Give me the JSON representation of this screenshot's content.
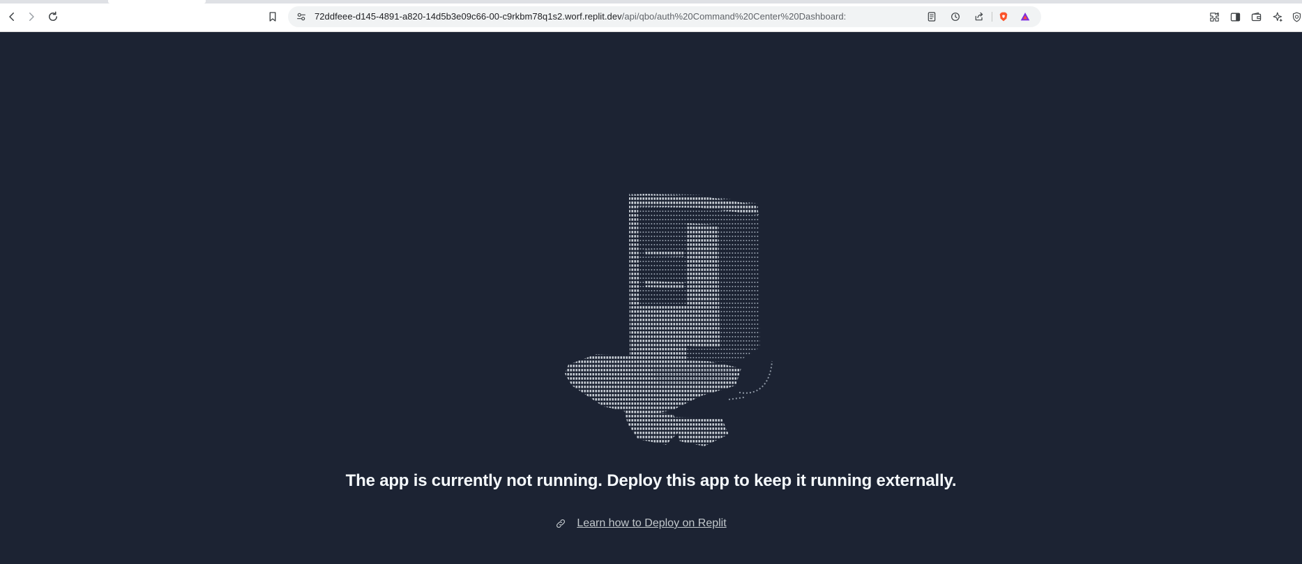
{
  "browser": {
    "url_host": "72ddfeee-d145-4891-a820-14d5b3e09c66-00-c9rkbm78q1s2.worf.replit.dev",
    "url_path": "/api/qbo/auth%20Command%20Center%20Dashboard:",
    "nav_icons": [
      "back-icon",
      "forward-icon",
      "reload-icon",
      "bookmark-icon"
    ],
    "omnibox_icons": [
      "site-info-icon",
      "reader-mode-icon",
      "history-icon",
      "share-icon",
      "brave-shields-icon",
      "brave-rewards-icon"
    ],
    "toolbar_icons": [
      "extensions-icon",
      "sidebar-icon",
      "wallet-icon",
      "leo-ai-icon",
      "vpn-icon"
    ],
    "colors": {
      "chrome_bg": "#ffffff",
      "omnibox_bg": "#f1f3f4",
      "brave_orange": "#fb542b"
    }
  },
  "page": {
    "background": "#1c2333",
    "message": "The app is currently not running. Deploy this app to keep it running externally.",
    "learn_link": "Learn how to Deploy on Replit",
    "link_icon": "link-icon",
    "illustration": "ascii-art-mascot",
    "colors": {
      "text": "#f5f9fc",
      "link": "#c2c8cc"
    }
  }
}
